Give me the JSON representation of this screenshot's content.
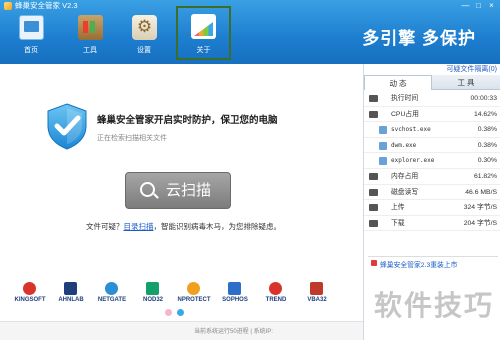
{
  "window": {
    "title": "蜂巢安全管家 V2.3",
    "controls": [
      "—",
      "□",
      "×"
    ]
  },
  "tabs": [
    {
      "label": "首页",
      "selected": false
    },
    {
      "label": "工具",
      "selected": false
    },
    {
      "label": "设置",
      "selected": false
    },
    {
      "label": "关于",
      "selected": true
    }
  ],
  "header": {
    "slogan": "多引擎 多保护"
  },
  "main": {
    "protect_heading": "蜂巢安全管家开启实时防护，保卫您的电脑",
    "scan_status": "正在检索扫描相关文件",
    "cloud_scan_label": "云扫描",
    "suspect_prefix": "文件可疑？",
    "suspect_link": "目录扫描",
    "suspect_suffix": "，智能识别病毒木马，为您排除疑虑。"
  },
  "partners": [
    {
      "name": "KINGSOFT",
      "color": "#d9342b",
      "icon": "kingsoft-logo"
    },
    {
      "name": "AHNLAB",
      "color": "#1f3e7a",
      "icon": "ahnlab-logo"
    },
    {
      "name": "NETGATE",
      "color": "#2a8fd4",
      "icon": "netgate-logo"
    },
    {
      "name": "NOD32",
      "color": "#14a06a",
      "icon": "eset-logo"
    },
    {
      "name": "NPROTECT",
      "color": "#f0a020",
      "icon": "nprotect-logo"
    },
    {
      "name": "SOPHOS",
      "color": "#2d6ec9",
      "icon": "sophos-logo"
    },
    {
      "name": "TREND",
      "color": "#d9342b",
      "icon": "trend-logo"
    },
    {
      "name": "VBA32",
      "color": "#c0392b",
      "icon": "vba32-logo"
    }
  ],
  "carousel": {
    "active_index": 1,
    "colors": [
      "#f7b6c8",
      "#38a8e8"
    ]
  },
  "footer": {
    "text": "当前系统运行50进程 | 系统IP:"
  },
  "panel": {
    "quarantine_link": "可疑文件隔离(0)",
    "tabs": [
      "动 态",
      "工 具"
    ],
    "stats": [
      {
        "label": "执行时间",
        "value": "00:00:33",
        "icon": "clock-icon",
        "kind": "stat"
      },
      {
        "label": "CPU占用",
        "value": "14.62%",
        "icon": "cpu-icon",
        "kind": "stat"
      },
      {
        "label": "svchost.exe",
        "value": "0.38%",
        "icon": "process-icon",
        "kind": "proc"
      },
      {
        "label": "dwm.exe",
        "value": "0.38%",
        "icon": "process-icon",
        "kind": "proc"
      },
      {
        "label": "explorer.exe",
        "value": "0.30%",
        "icon": "process-icon",
        "kind": "proc"
      },
      {
        "label": "内存占用",
        "value": "61.82%",
        "icon": "memory-icon",
        "kind": "stat"
      },
      {
        "label": "磁盘读写",
        "value": "46.6 MB/S",
        "icon": "disk-icon",
        "kind": "stat"
      },
      {
        "label": "上传",
        "value": "324 字节/S",
        "icon": "upload-icon",
        "kind": "stat"
      },
      {
        "label": "下载",
        "value": "204 字节/S",
        "icon": "download-icon",
        "kind": "stat"
      }
    ],
    "news": "蜂巢安全管家2.3重装上市"
  },
  "watermark": "软件技巧",
  "colors": {
    "header_top": "#3aa0e4",
    "header_bottom": "#176fbf",
    "link": "#1a5cc8",
    "scan_button": "#8c8c8c"
  }
}
